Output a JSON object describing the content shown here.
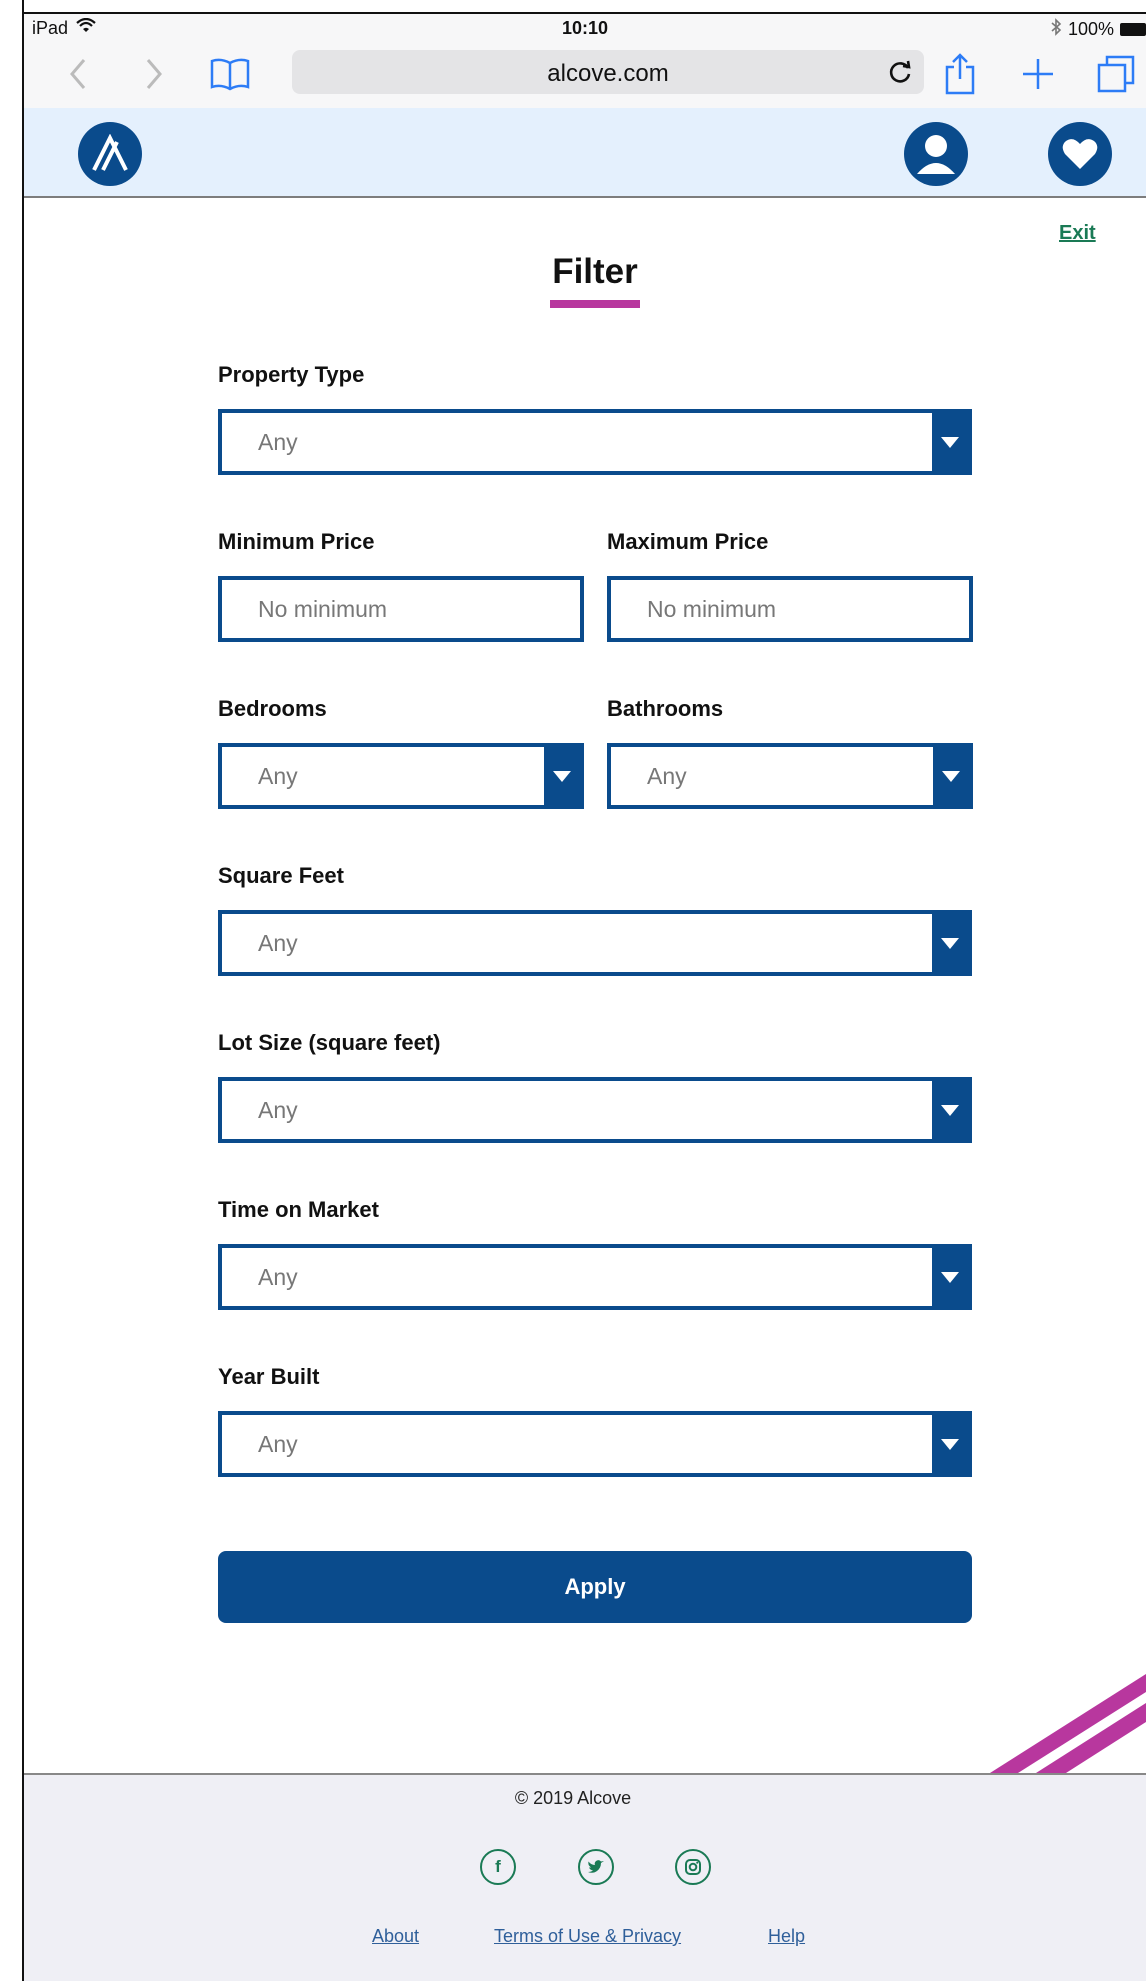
{
  "status_bar": {
    "device": "iPad",
    "time": "10:10",
    "battery": "100%"
  },
  "browser": {
    "url": "alcove.com"
  },
  "page": {
    "title": "Filter",
    "exit_label": "Exit"
  },
  "fields": {
    "property_type": {
      "label": "Property Type",
      "value": "Any"
    },
    "min_price": {
      "label": "Minimum Price",
      "placeholder": "No minimum"
    },
    "max_price": {
      "label": "Maximum Price",
      "placeholder": "No minimum"
    },
    "bedrooms": {
      "label": "Bedrooms",
      "value": "Any"
    },
    "bathrooms": {
      "label": "Bathrooms",
      "value": "Any"
    },
    "square_feet": {
      "label": "Square Feet",
      "value": "Any"
    },
    "lot_size": {
      "label": "Lot Size (square feet)",
      "value": "Any"
    },
    "time_on_market": {
      "label": "Time on Market",
      "value": "Any"
    },
    "year_built": {
      "label": "Year Built",
      "value": "Any"
    }
  },
  "apply_label": "Apply",
  "footer": {
    "copyright": "© 2019 Alcove",
    "links": [
      "About",
      "Terms of Use & Privacy",
      "Help"
    ]
  },
  "colors": {
    "brand_blue": "#0a4b8c",
    "accent_magenta": "#b8379e",
    "link_green": "#1a7a55",
    "header_bg": "#e4f0fd"
  }
}
